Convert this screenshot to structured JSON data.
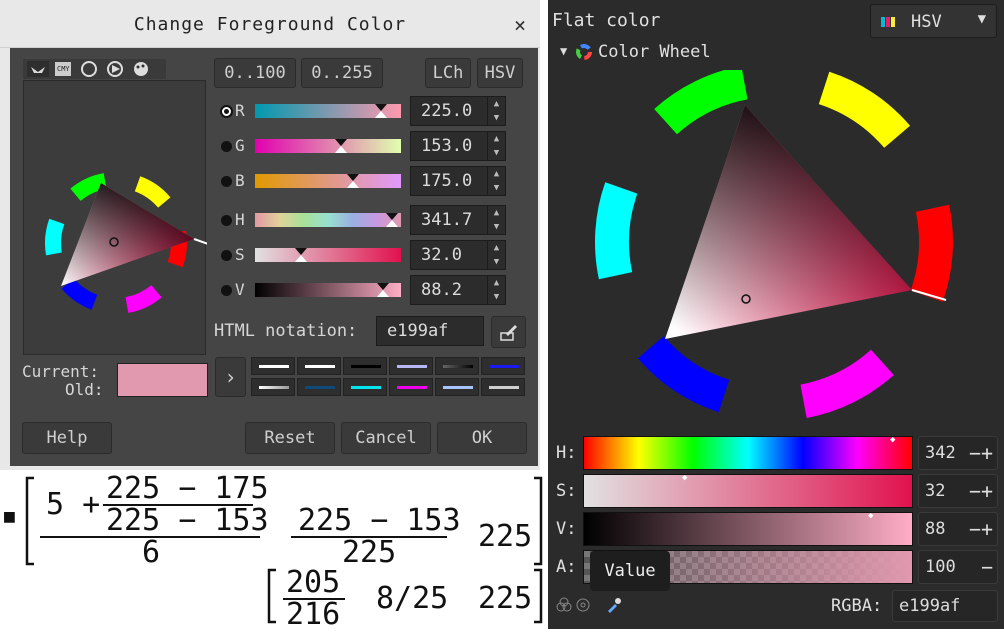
{
  "dialog": {
    "title": "Change Foreground Color",
    "close": "×",
    "range_buttons": [
      "0..100",
      "0..255"
    ],
    "mode_buttons": [
      "LCh",
      "HSV"
    ],
    "channels": [
      {
        "label": "R",
        "value": "225.0",
        "selected": true
      },
      {
        "label": "G",
        "value": "153.0"
      },
      {
        "label": "B",
        "value": "175.0"
      },
      {
        "label": "H",
        "value": "341.7"
      },
      {
        "label": "S",
        "value": "32.0"
      },
      {
        "label": "V",
        "value": "88.2"
      }
    ],
    "html_notation_label": "HTML notation:",
    "html_value": "e199af",
    "current_label": "Current:",
    "old_label": "Old:",
    "swatch_color": "#e199af",
    "buttons": {
      "help": "Help",
      "reset": "Reset",
      "cancel": "Cancel",
      "ok": "OK"
    }
  },
  "right_panel": {
    "title": "Flat color",
    "model": "HSV",
    "section": "Color Wheel",
    "sliders": [
      {
        "label": "H:",
        "value": "342"
      },
      {
        "label": "S:",
        "value": "32"
      },
      {
        "label": "V:",
        "value": "88"
      },
      {
        "label": "A:",
        "value": "100"
      }
    ],
    "tooltip": "Value",
    "rgba_label": "RGBA:",
    "rgba_value": "e199af"
  },
  "math": {
    "bullet": "■",
    "n1": "5 +",
    "num_a": "225 − 175",
    "den_a": "225 − 153",
    "six": "6",
    "num_b": "225 − 153",
    "den_b": "225",
    "c": "225",
    "r_num": "205",
    "r_den": "216",
    "r_mid": "8/25",
    "r_last": "225"
  }
}
